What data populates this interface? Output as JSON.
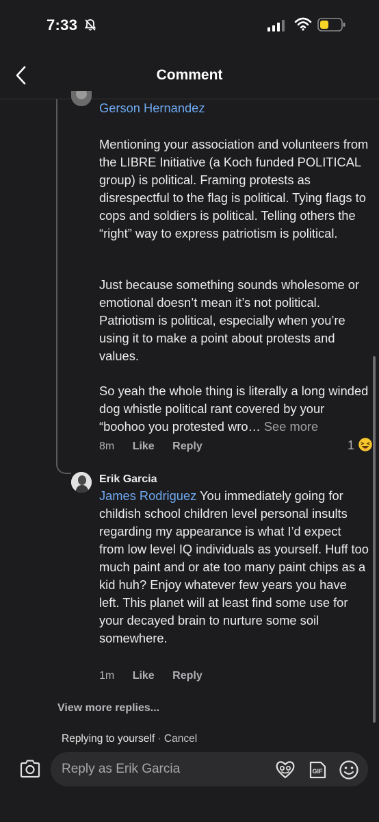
{
  "status_bar": {
    "time": "7:33",
    "icons": [
      "bell-slash-icon",
      "signal-icon",
      "wifi-icon",
      "battery-icon"
    ],
    "battery_color": "#f5d327"
  },
  "header": {
    "title": "Comment",
    "back_icon": "chevron-left-icon"
  },
  "comments": [
    {
      "author_mention": "Gerson Hernandez",
      "paragraphs": [
        "Mentioning your association and volunteers from the LIBRE Initiative (a Koch funded POLITICAL group) is political. Framing protests as disrespectful to the flag is political. Tying flags to cops and soldiers is political. Telling others the “right” way to express patriotism is political.",
        "Just because something sounds wholesome or emotional doesn’t mean it’s not political. Patriotism is political, especially when you’re using it to make a point about protests and values.",
        "So yeah the whole thing is literally a long winded dog whistle political rant covered by your “boohoo you protested wro…"
      ],
      "see_more": "See more",
      "time": "8m",
      "like_label": "Like",
      "reply_label": "Reply",
      "reaction_count": "1",
      "reaction_icon": "laughing-emoji-icon"
    },
    {
      "author": "Erik Garcia",
      "mention": "James Rodriguez",
      "text": " You immediately going for childish school children level personal insults regarding my appearance is what I’d expect from low level IQ individuals as yourself. Huff too much paint and or ate too many paint chips as a kid huh? Enjoy whatever few years you have left. This planet will at least find some use for your decayed brain to nurture some soil somewhere.",
      "time": "1m",
      "like_label": "Like",
      "reply_label": "Reply"
    }
  ],
  "view_more_replies": "View more replies...",
  "reply_bar": {
    "replying_to": "Replying to yourself",
    "separator": " · ",
    "cancel": "Cancel",
    "placeholder": "Reply as Erik Garcia",
    "icons": [
      "camera-icon",
      "sticker-icon",
      "gif-icon",
      "emoji-icon"
    ]
  },
  "colors": {
    "background": "#1c1c1e",
    "link": "#6ea8f0",
    "text": "#ececec",
    "muted": "#b0b0b4"
  }
}
